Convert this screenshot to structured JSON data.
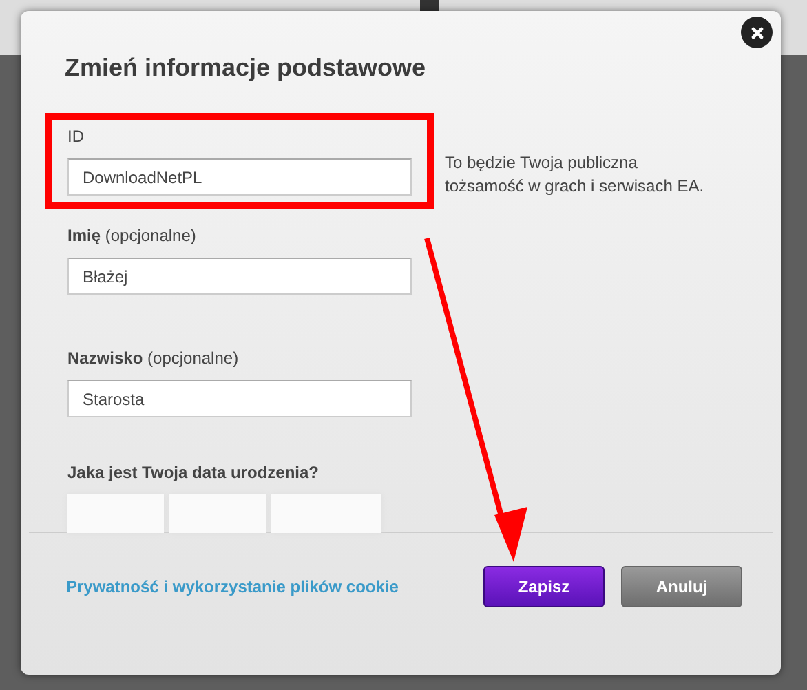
{
  "dialog": {
    "title": "Zmień informacje podstawowe",
    "fields": [
      {
        "label": "ID",
        "value": "DownloadNetPL",
        "highlighted": true,
        "hint": "To będzie Twoja publiczna tożsamość w grach i serwisach EA."
      },
      {
        "label": "**Imię** (opcjonalne)",
        "value": "Błażej",
        "highlighted": false
      },
      {
        "label": "**Nazwisko** (opcjonalne)",
        "value": "Starosta",
        "highlighted": false
      }
    ],
    "birth_date": {
      "label": "Jaka jest Twoja data urodzenia?",
      "fields": [
        {
          "kind": "day"
        },
        {
          "kind": "month"
        },
        {
          "kind": "year"
        }
      ]
    },
    "footer": {
      "link": "Prywatność i wykorzystanie plików cookie",
      "buttons": [
        {
          "label": "Zapisz",
          "kind": "primary"
        },
        {
          "label": "Anuluj",
          "kind": "secondary"
        }
      ]
    }
  }
}
